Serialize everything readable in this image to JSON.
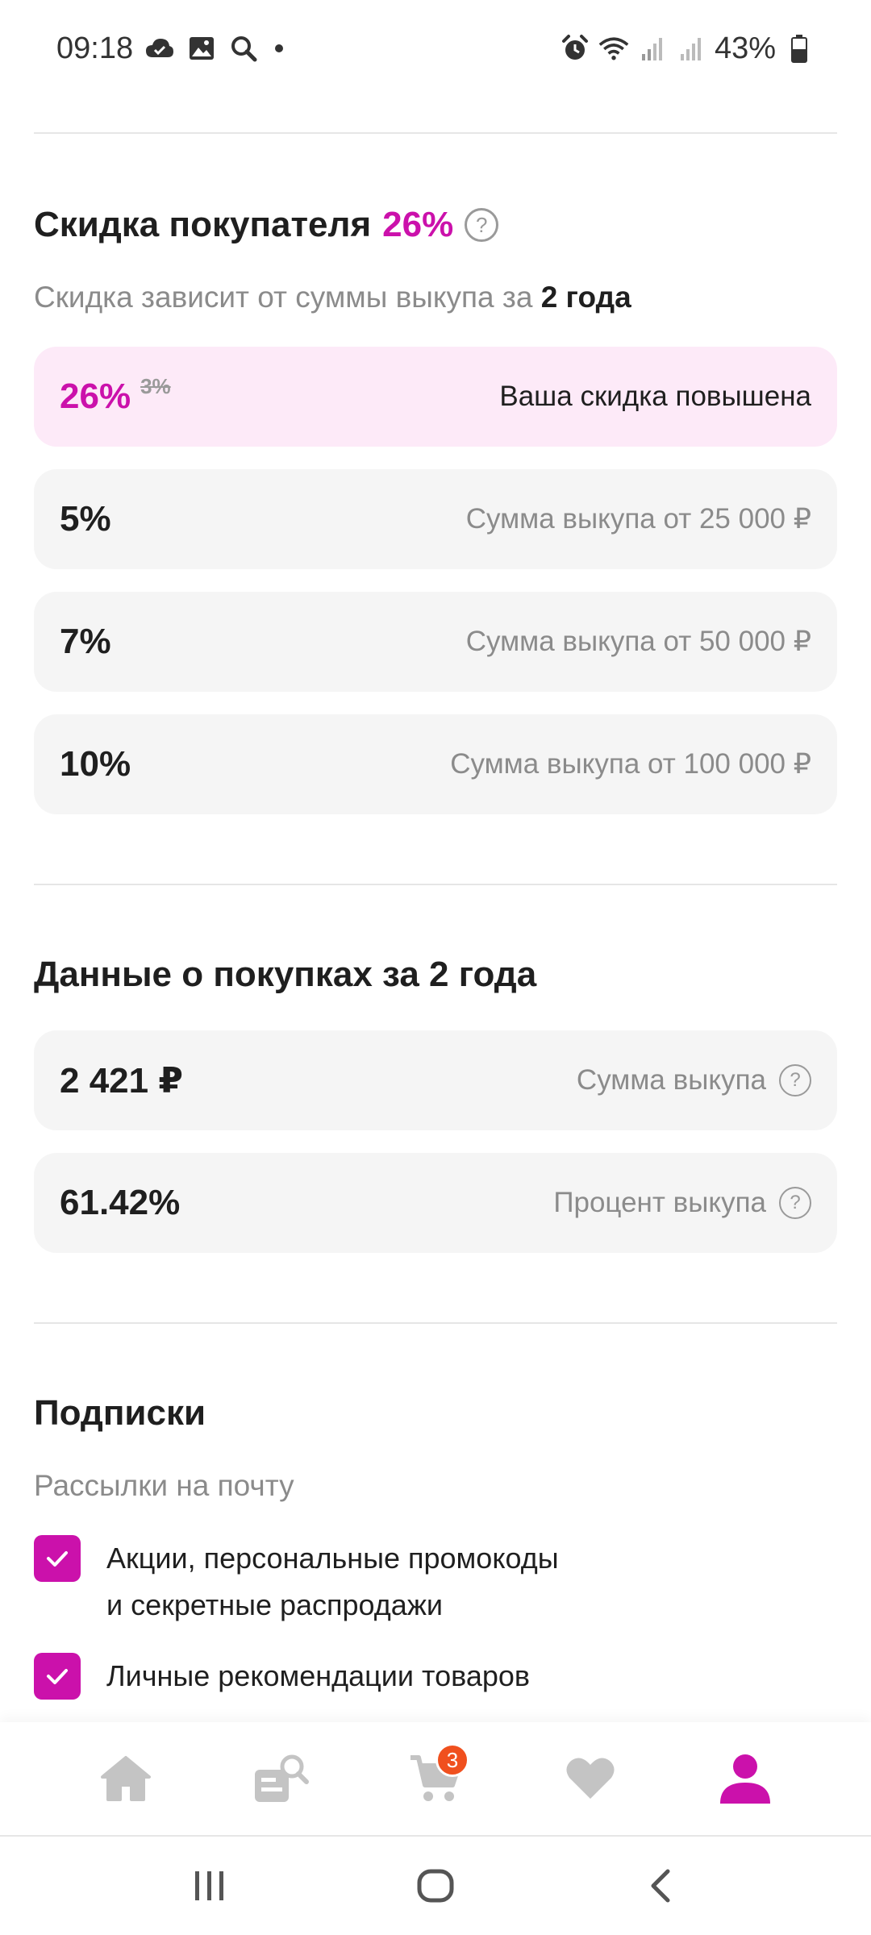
{
  "status_bar": {
    "time": "09:18",
    "battery": "43%",
    "left_icons": [
      "cloud-icon",
      "image-icon",
      "search-icon",
      "dot-icon"
    ],
    "right_icons": [
      "alarm-icon",
      "wifi-icon",
      "signal-icon",
      "signal-icon",
      "battery-icon"
    ]
  },
  "discount": {
    "title": "Скидка покупателя",
    "value": "26%",
    "subtitle_prefix": "Скидка зависит от суммы выкупа за ",
    "subtitle_bold": "2 года",
    "current": {
      "value": "26%",
      "old_value": "3%",
      "label": "Ваша скидка повышена"
    },
    "tiers": [
      {
        "value": "5%",
        "label": "Сумма выкупа от 25 000 ₽"
      },
      {
        "value": "7%",
        "label": "Сумма выкупа от 50 000 ₽"
      },
      {
        "value": "10%",
        "label": "Сумма выкупа от 100 000 ₽"
      }
    ]
  },
  "purchases": {
    "title": "Данные о покупках за 2 года",
    "rows": [
      {
        "value": "2 421 ₽",
        "label": "Сумма выкупа"
      },
      {
        "value": "61.42%",
        "label": "Процент выкупа"
      }
    ]
  },
  "subscriptions": {
    "title": "Подписки",
    "subtitle": "Рассылки на почту",
    "items": [
      {
        "label_line1": "Акции, персональные промокоды",
        "label_line2": "и секретные распродажи",
        "checked": true
      },
      {
        "label_line1": "Личные рекомендации товаров",
        "checked": true
      }
    ]
  },
  "bottom_nav": {
    "items": [
      "home-icon",
      "catalog-search-icon",
      "cart-icon",
      "favorites-icon",
      "profile-icon"
    ],
    "cart_badge": "3",
    "active": "profile-icon"
  },
  "colors": {
    "accent": "#cb11ab",
    "badge": "#f0501e",
    "inactive_icon": "#c4c4c4"
  }
}
